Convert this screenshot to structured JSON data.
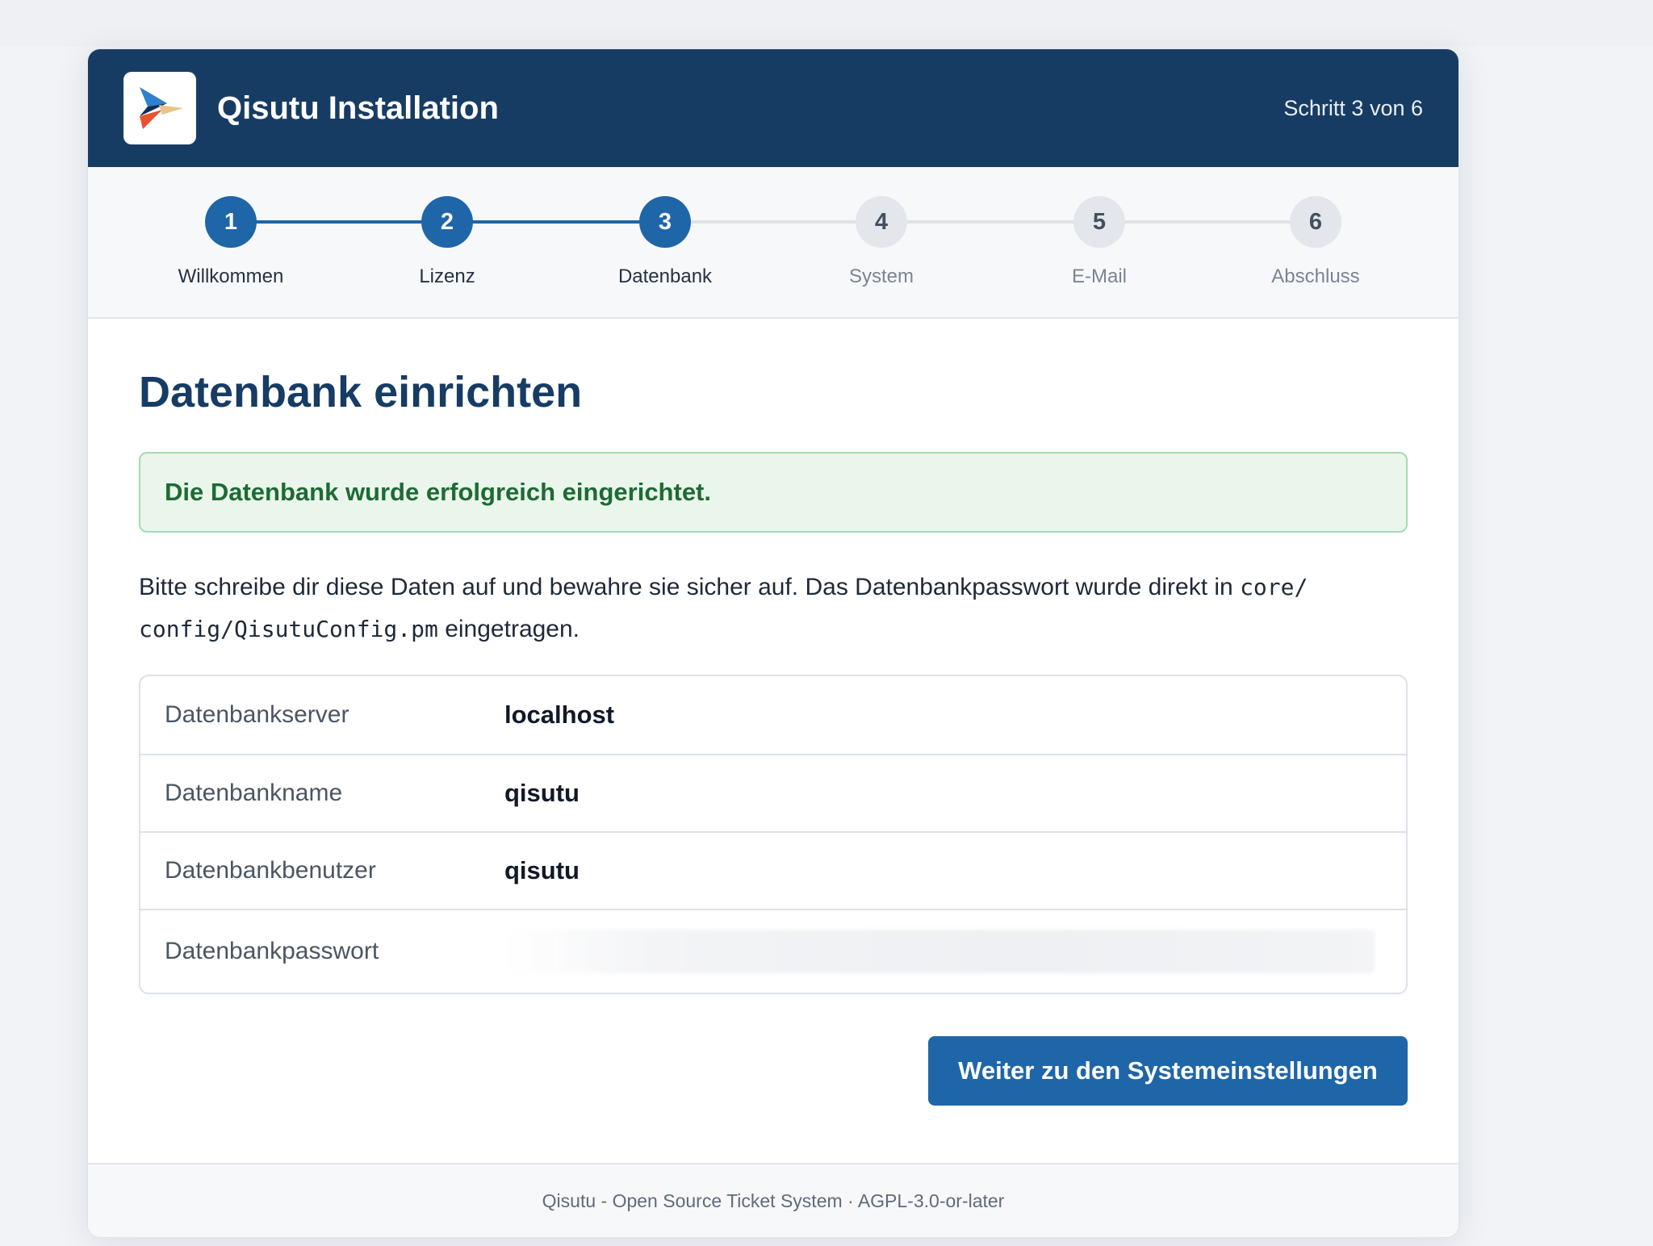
{
  "header": {
    "title": "Qisutu Installation",
    "step_indicator": "Schritt 3 von 6",
    "logo_icon": "qisutu-logo",
    "background_color": "#173c64"
  },
  "stepper": {
    "steps": [
      {
        "number": "1",
        "label": "Willkommen",
        "state": "done"
      },
      {
        "number": "2",
        "label": "Lizenz",
        "state": "done"
      },
      {
        "number": "3",
        "label": "Datenbank",
        "state": "current"
      },
      {
        "number": "4",
        "label": "System",
        "state": "todo"
      },
      {
        "number": "5",
        "label": "E-Mail",
        "state": "todo"
      },
      {
        "number": "6",
        "label": "Abschluss",
        "state": "todo"
      }
    ],
    "active_color": "#1f66a8"
  },
  "main": {
    "title": "Datenbank einrichten",
    "success_message": "Die Datenbank wurde erfolgreich eingerichtet.",
    "intro_text_1": "Bitte schreibe dir diese Daten auf und bewahre sie sicher auf. Das Datenbankpasswort wurde direkt in ",
    "intro_code": "core/​config/QisutuConfig.pm",
    "intro_text_2": " eingetragen.",
    "details": [
      {
        "key": "Datenbankserver",
        "value": "localhost"
      },
      {
        "key": "Datenbankname",
        "value": "qisutu"
      },
      {
        "key": "Datenbankbenutzer",
        "value": "qisutu"
      },
      {
        "key": "Datenbankpasswort",
        "value": ""
      }
    ],
    "continue_button": "Weiter zu den Systemeinstellungen"
  },
  "footer": {
    "text": "Qisutu - Open Source Ticket System · AGPL-3.0-or-later"
  }
}
